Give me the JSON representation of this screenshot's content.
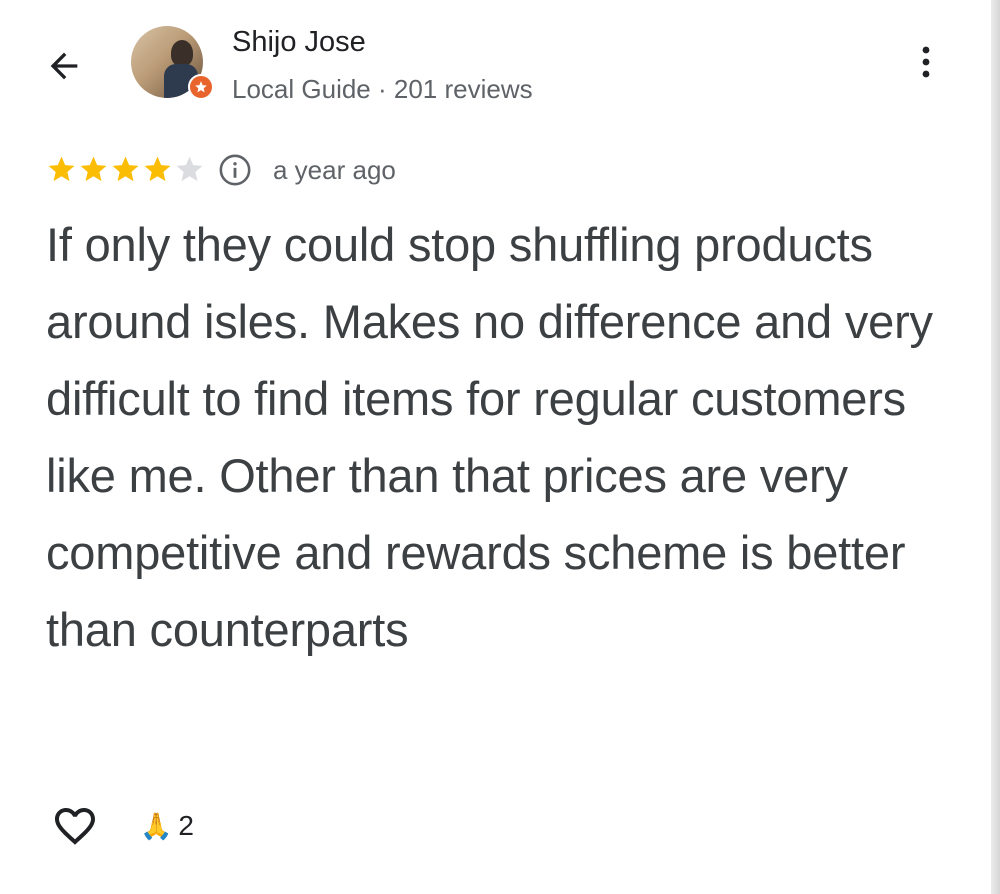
{
  "reviewer": {
    "name": "Shijo Jose",
    "meta": "Local Guide · 201 reviews"
  },
  "review": {
    "rating": 4,
    "max_rating": 5,
    "time": "a year ago",
    "text": "If only they could stop shuffling products around isles. Makes no difference and very difficult to find items for regular customers like me. Other than that prices are very competitive and rewards scheme is better than counterparts"
  },
  "reactions": {
    "emoji": "🙏",
    "count": "2"
  },
  "icons": {
    "back": "arrow-back-icon",
    "more": "more-vert-icon",
    "info": "info-icon",
    "like": "heart-outline-icon",
    "badge": "local-guide-star-icon"
  },
  "colors": {
    "star_filled": "#fbbc04",
    "star_empty": "#dadce0",
    "text_primary": "#202124",
    "text_secondary": "#5f6368",
    "body_text": "#3c4043",
    "badge": "#e8642c"
  }
}
